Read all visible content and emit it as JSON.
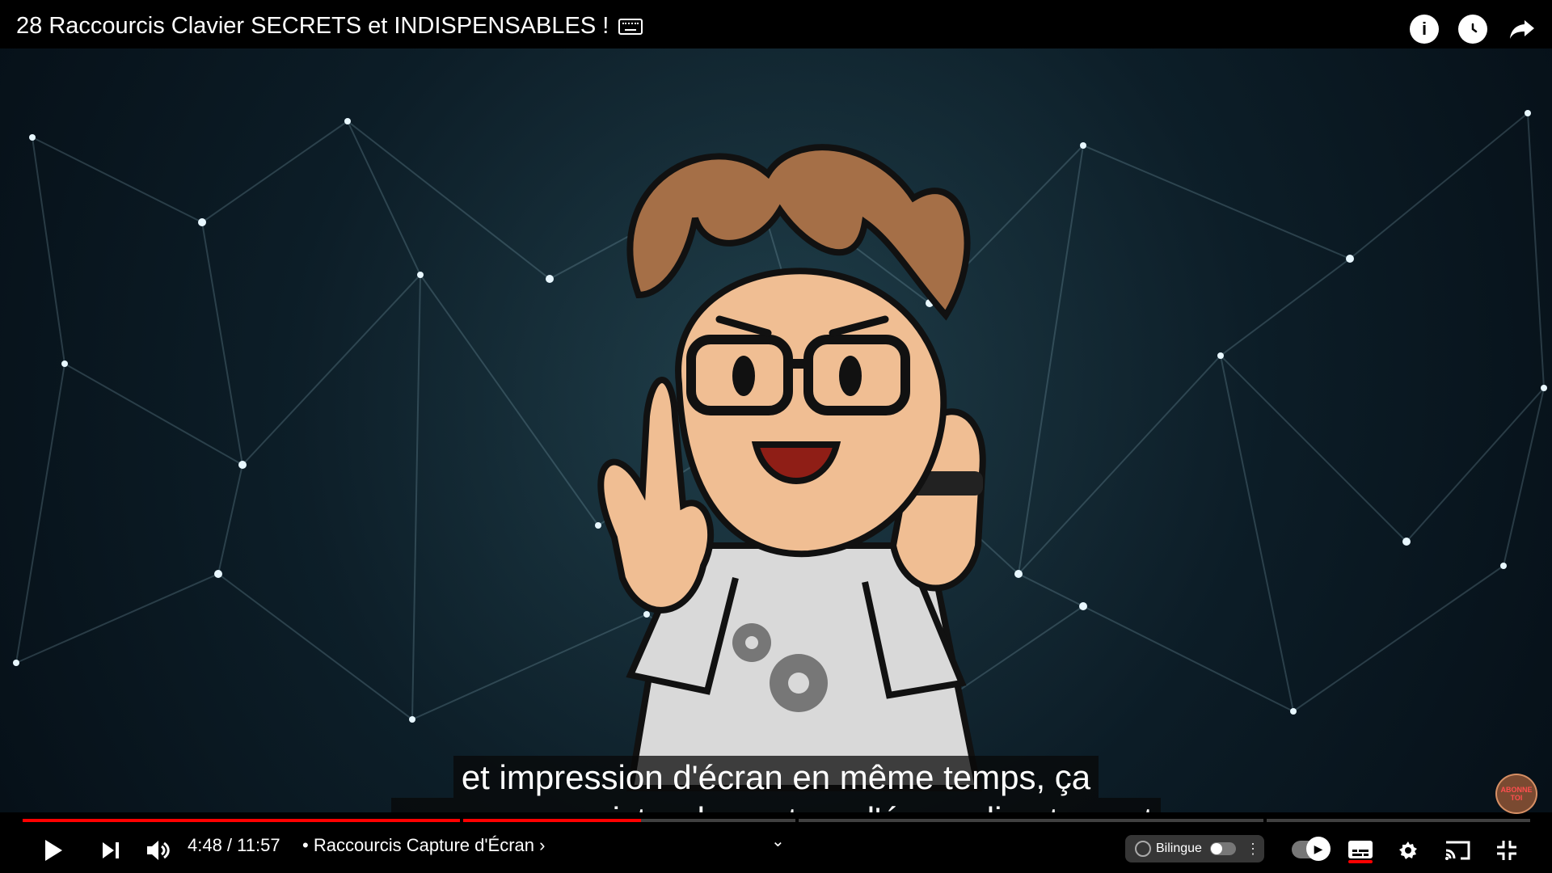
{
  "header": {
    "title": "28 Raccourcis Clavier SECRETS et INDISPENSABLES !",
    "title_icon": "keyboard-icon",
    "actions": [
      "info-icon",
      "watch-later-icon",
      "share-icon"
    ]
  },
  "video": {
    "subtitle_lines": [
      "et impression d'écran en même temps, ça",
      "va vous enregistrer la capture d'écran directement"
    ],
    "watermark": "ABONNE TOI",
    "progress_fraction": 0.41
  },
  "player": {
    "time": "4:48 / 11:57",
    "chapter": "• Raccourcis Capture d'Écran ›",
    "bilingual_label": "Bilingue",
    "accent_color": "#ff0000",
    "controls": [
      "play-icon",
      "next-icon",
      "volume-icon",
      "chevron-down-icon",
      "autoplay-toggle",
      "subtitles-icon",
      "settings-icon",
      "cast-icon",
      "exit-fullscreen-icon"
    ]
  }
}
